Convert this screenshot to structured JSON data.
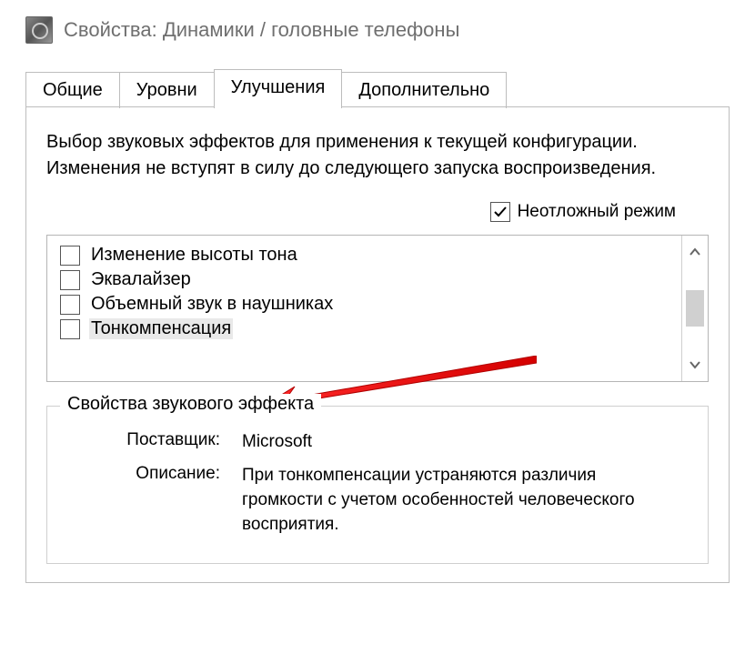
{
  "window": {
    "title": "Свойства: Динамики / головные телефоны"
  },
  "tabs": {
    "items": [
      {
        "label": "Общие",
        "active": false
      },
      {
        "label": "Уровни",
        "active": false
      },
      {
        "label": "Улучшения",
        "active": true
      },
      {
        "label": "Дополнительно",
        "active": false
      }
    ]
  },
  "content": {
    "description": "Выбор звуковых эффектов для применения к текущей конфигурации. Изменения не вступят в силу до следующего запуска воспроизведения.",
    "urgent_mode": {
      "label": "Неотложный режим",
      "checked": true
    },
    "effects": [
      {
        "label": "Изменение высоты тона",
        "checked": false
      },
      {
        "label": "Эквалайзер",
        "checked": false
      },
      {
        "label": "Объемный звук в наушниках",
        "checked": false
      },
      {
        "label": "Тонкомпенсация",
        "checked": false
      }
    ],
    "group": {
      "title": "Свойства звукового эффекта",
      "vendor_label": "Поставщик:",
      "vendor_value": "Microsoft",
      "desc_label": "Описание:",
      "desc_value": "При тонкомпенсации устраняются различия громкости с учетом особенностей человеческого восприятия."
    }
  }
}
